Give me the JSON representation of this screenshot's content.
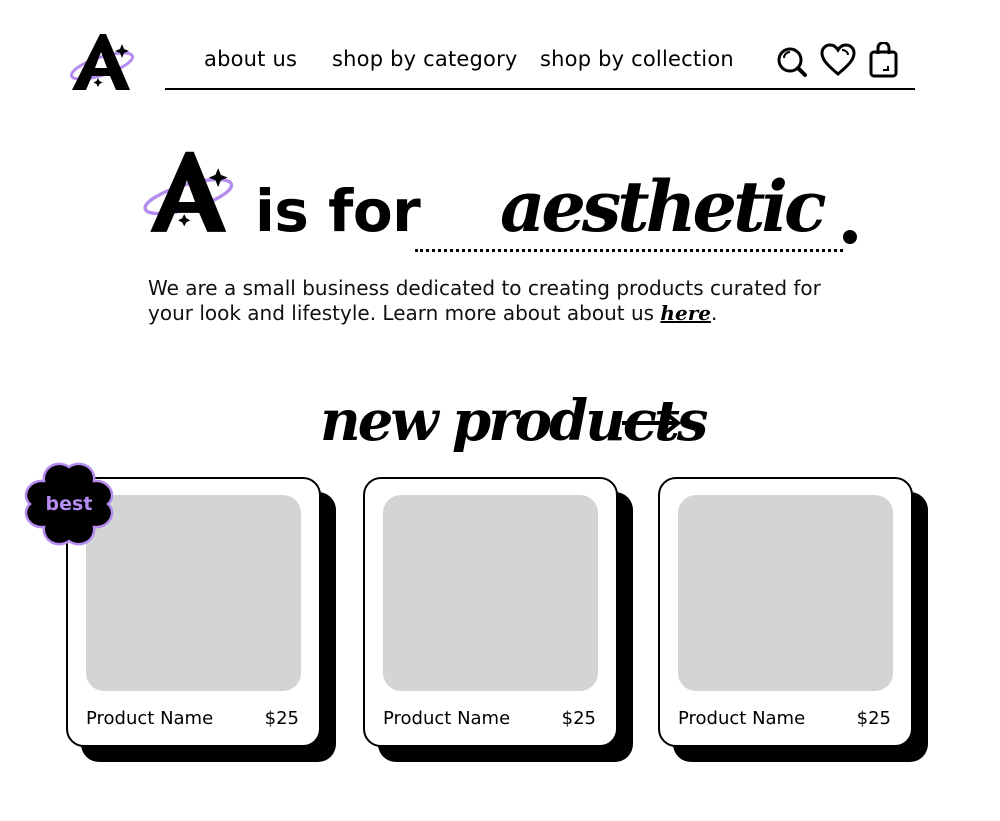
{
  "nav": {
    "links": [
      "about us",
      "shop by category",
      "shop by collection"
    ],
    "icons": [
      "search-icon",
      "heart-icon",
      "shopping-bag-icon"
    ]
  },
  "hero": {
    "is_for": "is for",
    "word": "aesthetic",
    "intro_text": "We are a small business dedicated to creating products curated for your look and lifestyle. Learn more about about us ",
    "link_text": "here",
    "intro_end": "."
  },
  "section": {
    "title": "new products",
    "arrow_icon": "arrow-right-icon"
  },
  "badge": {
    "label": "best"
  },
  "products": [
    {
      "name": "Product Name",
      "price": "$25"
    },
    {
      "name": "Product Name",
      "price": "$25"
    },
    {
      "name": "Product Name",
      "price": "$25"
    }
  ],
  "colors": {
    "accent": "#b58cf0",
    "placeholder": "#d4d4d4",
    "ink": "#000000"
  }
}
